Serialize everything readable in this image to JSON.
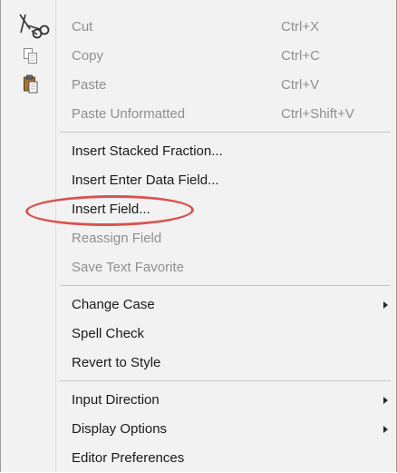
{
  "menu": {
    "items": [
      {
        "label": "Cut",
        "shortcut": "Ctrl+X",
        "icon": "scissors-icon"
      },
      {
        "label": "Copy",
        "shortcut": "Ctrl+C",
        "icon": "copy-icon"
      },
      {
        "label": "Paste",
        "shortcut": "Ctrl+V",
        "icon": "paste-icon"
      },
      {
        "label": "Paste Unformatted",
        "shortcut": "Ctrl+Shift+V"
      },
      {
        "label": "Insert Stacked Fraction..."
      },
      {
        "label": "Insert Enter Data Field..."
      },
      {
        "label": "Insert Field..."
      },
      {
        "label": "Reassign Field"
      },
      {
        "label": "Save Text Favorite"
      },
      {
        "label": "Change Case"
      },
      {
        "label": "Spell Check"
      },
      {
        "label": "Revert to Style"
      },
      {
        "label": "Input Direction"
      },
      {
        "label": "Display Options"
      },
      {
        "label": "Editor Preferences"
      }
    ]
  },
  "colors": {
    "menu_bg": "#f2f2f2",
    "disabled_text": "#8f8f8f",
    "highlight_ring": "#d9534f"
  }
}
